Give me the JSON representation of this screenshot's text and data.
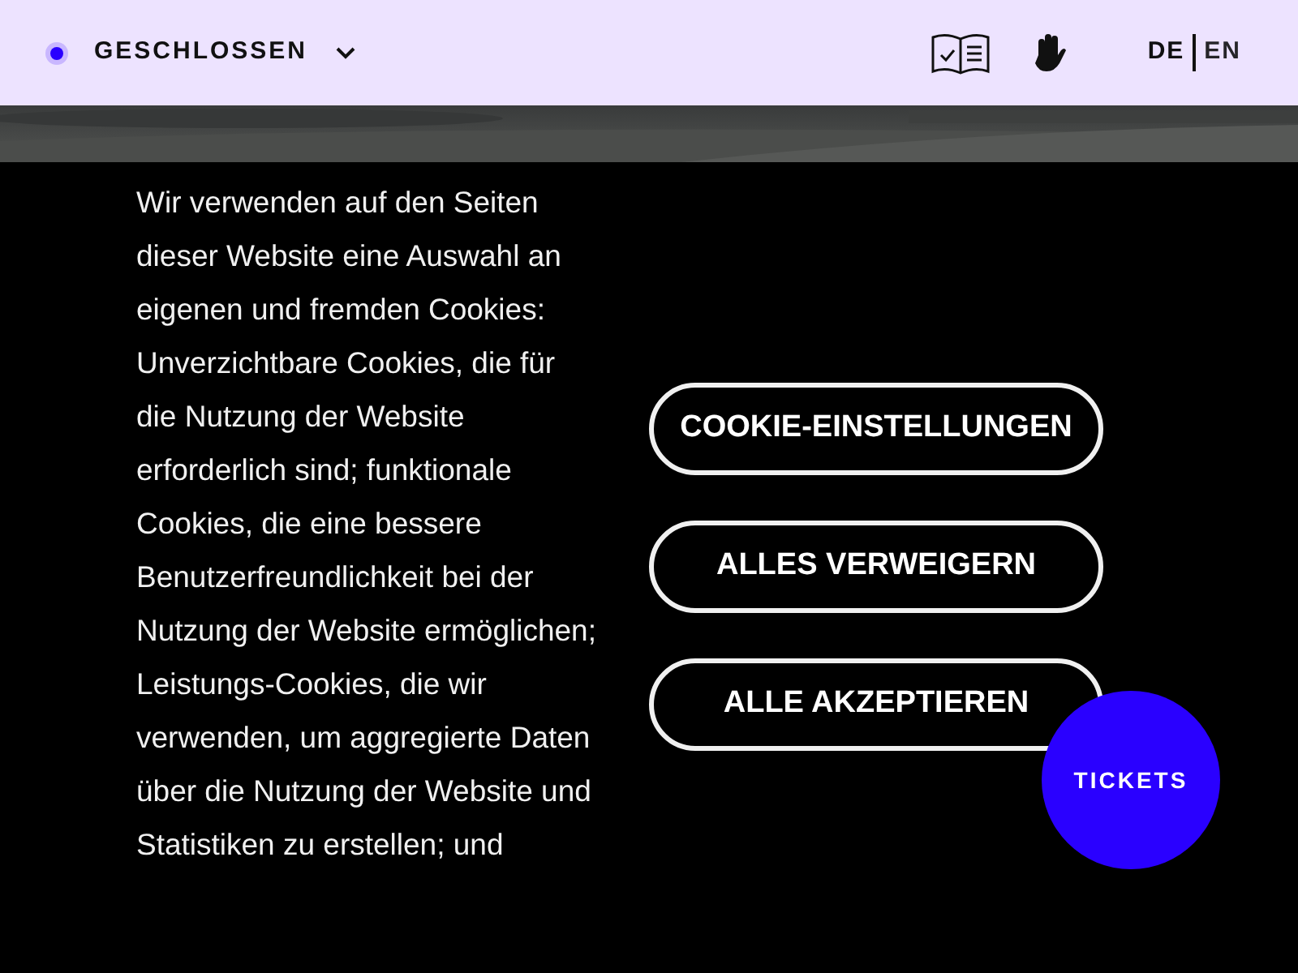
{
  "header": {
    "status": {
      "label": "GESCHLOSSEN",
      "color": "#2a00ff"
    },
    "languages": [
      {
        "label": "DE",
        "selected": true
      },
      {
        "label": "EN",
        "selected": false
      }
    ]
  },
  "cookie_banner": {
    "text": "Wir verwenden auf den Seiten dieser Website eine Auswahl an eigenen und fremden Cookies: Unverzichtbare Cookies, die für die Nutzung der Website erforderlich sind; funktionale Cookies, die eine bessere Benutzerfreundlichkeit bei der Nutzung der Website ermöglichen; Leistungs-Cookies, die wir verwenden, um aggregierte Daten über die Nutzung der Website und Statistiken zu erstellen; und",
    "buttons": [
      "COOKIE-EINSTELLUNGEN",
      "ALLES VERWEIGERN",
      "ALLE AKZEPTIEREN"
    ]
  },
  "tickets_button": "TICKETS"
}
